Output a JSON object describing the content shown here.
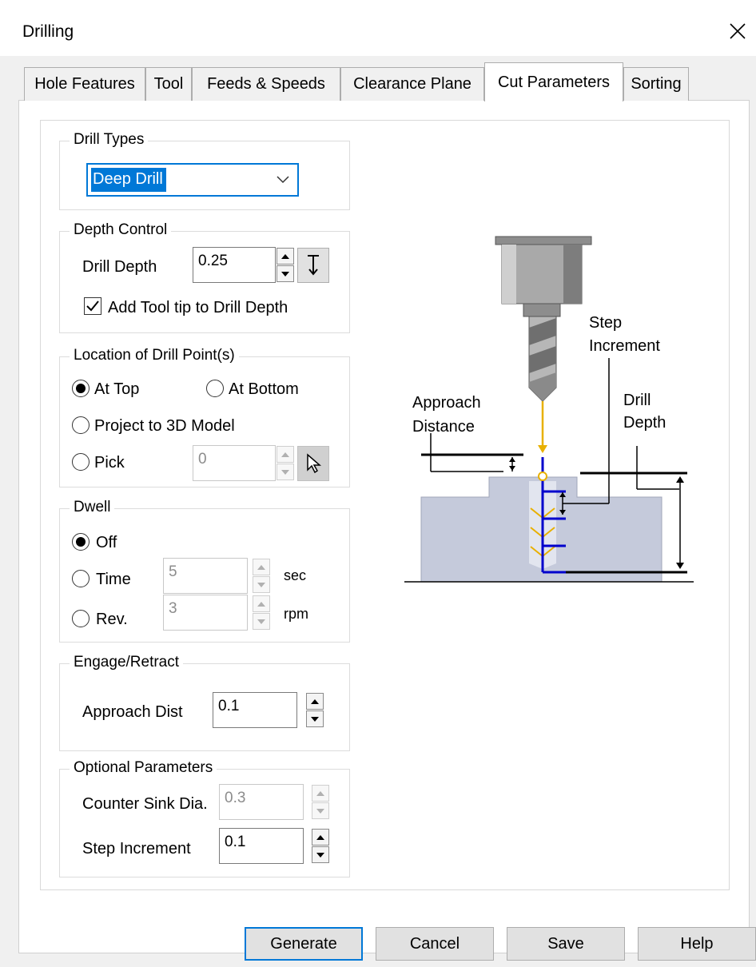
{
  "window": {
    "title": "Drilling",
    "close_icon": "close-icon"
  },
  "tabs": [
    "Hole Features",
    "Tool",
    "Feeds & Speeds",
    "Clearance Plane",
    "Cut Parameters",
    "Sorting"
  ],
  "active_tab": "Cut Parameters",
  "drill_types": {
    "legend": "Drill Types",
    "selected": "Deep Drill"
  },
  "depth_control": {
    "legend": "Depth Control",
    "drill_depth_label": "Drill Depth",
    "drill_depth_value": "0.25",
    "add_tool_tip_label": "Add Tool tip to Drill Depth",
    "add_tool_tip_checked": true
  },
  "location": {
    "legend": "Location of Drill Point(s)",
    "at_top": "At Top",
    "at_bottom": "At Bottom",
    "project": "Project to 3D Model",
    "pick": "Pick",
    "pick_value": "0",
    "selected": "At Top"
  },
  "dwell": {
    "legend": "Dwell",
    "off": "Off",
    "time": "Time",
    "rev": "Rev.",
    "time_value": "5",
    "time_unit": "sec",
    "rev_value": "3",
    "rev_unit": "rpm",
    "selected": "Off"
  },
  "engage": {
    "legend": "Engage/Retract",
    "approach_label": "Approach Dist",
    "approach_value": "0.1"
  },
  "optional": {
    "legend": "Optional Parameters",
    "counter_sink_label": "Counter Sink Dia.",
    "counter_sink_value": "0.3",
    "step_label": "Step Increment",
    "step_value": "0.1"
  },
  "diagram": {
    "step_increment": [
      "Step",
      "Increment"
    ],
    "approach_distance": [
      "Approach",
      "Distance"
    ],
    "drill_depth": [
      "Drill",
      "Depth"
    ]
  },
  "buttons": {
    "generate": "Generate",
    "cancel": "Cancel",
    "save": "Save",
    "help": "Help"
  },
  "colors": {
    "accent": "#0078d7",
    "drill_path": "#0000cc",
    "approach_line": "#e8b000",
    "stock": "#c5cadb"
  }
}
